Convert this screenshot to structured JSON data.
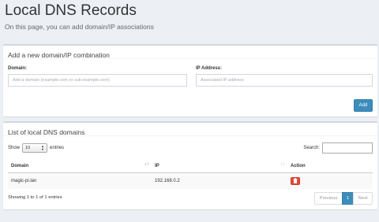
{
  "page": {
    "title": "Local DNS Records",
    "subtitle": "On this page, you can add domain/IP associations"
  },
  "add_box": {
    "title": "Add a new domain/IP combination",
    "domain_label": "Domain:",
    "domain_placeholder": "Add a domain (example.com or sub.example.com)",
    "ip_label": "IP Address:",
    "ip_placeholder": "Associated IP address",
    "add_button": "Add"
  },
  "list_box": {
    "title": "List of local DNS domains",
    "show_label": "Show",
    "show_value": "10",
    "entries_label": "entries",
    "search_label": "Search:",
    "columns": [
      "Domain",
      "IP",
      "Action"
    ],
    "rows": [
      {
        "domain": "magic-pi.lan",
        "ip": "192.168.0.2"
      }
    ],
    "info": "Showing 1 to 1 of 1 entries",
    "pagination": {
      "previous": "Previous",
      "current": "1",
      "next": "Next"
    }
  },
  "icons": {
    "sort_active": "sort-alpha-icon",
    "sort_inactive": "sort-icon",
    "delete": "trash-icon",
    "select_caret": "chevron-down-icon"
  },
  "colors": {
    "primary": "#3c8dbc",
    "danger": "#dd4b39",
    "background": "#ecf0f5"
  }
}
